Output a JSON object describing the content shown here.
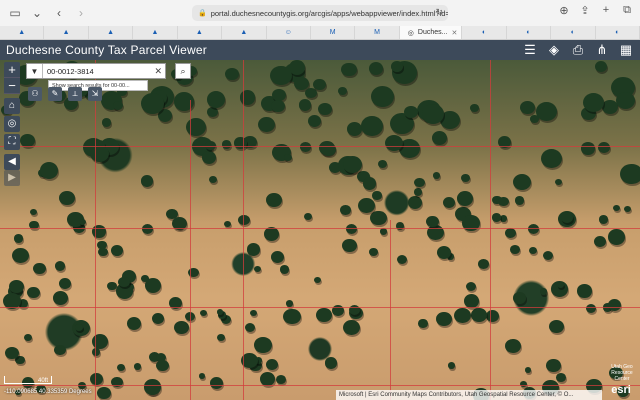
{
  "browser": {
    "url": "portal.duchesnecountygis.org/arcgis/apps/webappviewer/index.html?id=",
    "tabs": [
      {
        "label": "",
        "icon": "site-icon"
      },
      {
        "label": "",
        "icon": "site-icon"
      },
      {
        "label": "",
        "icon": "site-icon"
      },
      {
        "label": "",
        "icon": "site-icon"
      },
      {
        "label": "",
        "icon": "site-icon"
      },
      {
        "label": "",
        "icon": "site-icon"
      },
      {
        "label": "",
        "icon": "smile-icon"
      },
      {
        "label": "",
        "icon": "gmail-icon"
      },
      {
        "label": "",
        "icon": "gmail-icon"
      },
      {
        "label": "Duches...",
        "icon": "esri-icon",
        "active": true
      },
      {
        "label": "",
        "icon": "edge-icon"
      },
      {
        "label": "",
        "icon": "edge-icon"
      },
      {
        "label": "",
        "icon": "edge-icon"
      },
      {
        "label": "",
        "icon": "edge-icon"
      }
    ]
  },
  "app": {
    "title": "Duchesne County Tax Parcel Viewer"
  },
  "search": {
    "value": "00-0012-3814",
    "suggestion": "Show search results for 00-00..."
  },
  "map": {
    "scale_label": "40ft",
    "coordinates": "-110.090685 40.335359 Degrees",
    "attribution": "Microsoft | Esri Community Maps Contributors, Utah Geospatial Resource Center, © O...",
    "esri_logo": "esri",
    "esri_small": "Utah Geo Resource Center"
  },
  "colors": {
    "header_bg": "#3d4a5a",
    "parcel_line": "#d23c3c"
  }
}
